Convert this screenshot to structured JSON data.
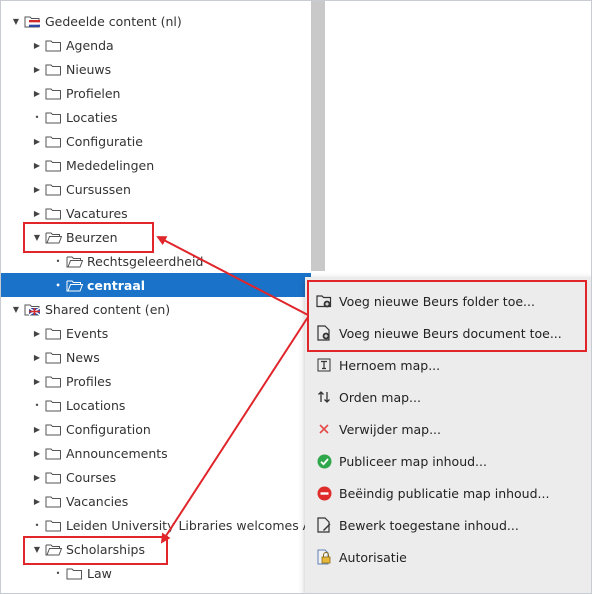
{
  "tree": {
    "items": [
      {
        "label": "Gedeelde content (nl)",
        "toggle": "▼",
        "icon": "flag-nl-folder-icon",
        "indent": 0
      },
      {
        "label": "Agenda",
        "toggle": "▶",
        "icon": "folder-icon",
        "indent": 1
      },
      {
        "label": "Nieuws",
        "toggle": "▶",
        "icon": "folder-icon",
        "indent": 1
      },
      {
        "label": "Profielen",
        "toggle": "▶",
        "icon": "folder-icon",
        "indent": 1
      },
      {
        "label": "Locaties",
        "toggle": "•",
        "icon": "folder-icon",
        "indent": 1
      },
      {
        "label": "Configuratie",
        "toggle": "▶",
        "icon": "folder-icon",
        "indent": 1
      },
      {
        "label": "Mededelingen",
        "toggle": "▶",
        "icon": "folder-icon",
        "indent": 1
      },
      {
        "label": "Cursussen",
        "toggle": "▶",
        "icon": "folder-icon",
        "indent": 1
      },
      {
        "label": "Vacatures",
        "toggle": "▶",
        "icon": "folder-icon",
        "indent": 1
      },
      {
        "label": "Beurzen",
        "toggle": "▼",
        "icon": "folder-open-icon",
        "indent": 1
      },
      {
        "label": "Rechtsgeleerdheid",
        "toggle": "•",
        "icon": "folder-open-icon",
        "indent": 2
      },
      {
        "label": "centraal",
        "toggle": "•",
        "icon": "folder-open-icon",
        "indent": 2,
        "selected": true
      },
      {
        "label": "Shared content (en)",
        "toggle": "▼",
        "icon": "flag-en-folder-icon",
        "indent": 0
      },
      {
        "label": "Events",
        "toggle": "▶",
        "icon": "folder-icon",
        "indent": 1
      },
      {
        "label": "News",
        "toggle": "▶",
        "icon": "folder-icon",
        "indent": 1
      },
      {
        "label": "Profiles",
        "toggle": "▶",
        "icon": "folder-icon",
        "indent": 1
      },
      {
        "label": "Locations",
        "toggle": "•",
        "icon": "folder-icon",
        "indent": 1
      },
      {
        "label": "Configuration",
        "toggle": "▶",
        "icon": "folder-icon",
        "indent": 1
      },
      {
        "label": "Announcements",
        "toggle": "▶",
        "icon": "folder-icon",
        "indent": 1
      },
      {
        "label": "Courses",
        "toggle": "▶",
        "icon": "folder-icon",
        "indent": 1
      },
      {
        "label": "Vacancies",
        "toggle": "▶",
        "icon": "folder-icon",
        "indent": 1
      },
      {
        "label": "Leiden University Libraries welcomes A",
        "toggle": "•",
        "icon": "folder-icon",
        "indent": 1
      },
      {
        "label": "Scholarships",
        "toggle": "▼",
        "icon": "folder-open-icon",
        "indent": 1
      },
      {
        "label": "Law",
        "toggle": "•",
        "icon": "folder-icon",
        "indent": 2
      }
    ]
  },
  "menu": {
    "items": [
      {
        "label": "Voeg nieuwe Beurs folder toe...",
        "icon": "add-folder-icon"
      },
      {
        "label": "Voeg nieuwe Beurs document toe...",
        "icon": "add-document-icon"
      },
      {
        "label": "Hernoem map...",
        "icon": "rename-icon"
      },
      {
        "label": "Orden map...",
        "icon": "sort-icon"
      },
      {
        "label": "Verwijder map...",
        "icon": "delete-icon"
      },
      {
        "label": "Publiceer map inhoud...",
        "icon": "publish-icon"
      },
      {
        "label": "Beëindig publicatie map inhoud...",
        "icon": "unpublish-icon"
      },
      {
        "label": "Bewerk toegestane inhoud...",
        "icon": "edit-allowed-content-icon"
      },
      {
        "label": "Autorisatie",
        "icon": "authorization-icon"
      }
    ]
  },
  "colors": {
    "selection": "#1a73c9",
    "highlight": "#e0252b",
    "menu_bg": "#ececec"
  }
}
